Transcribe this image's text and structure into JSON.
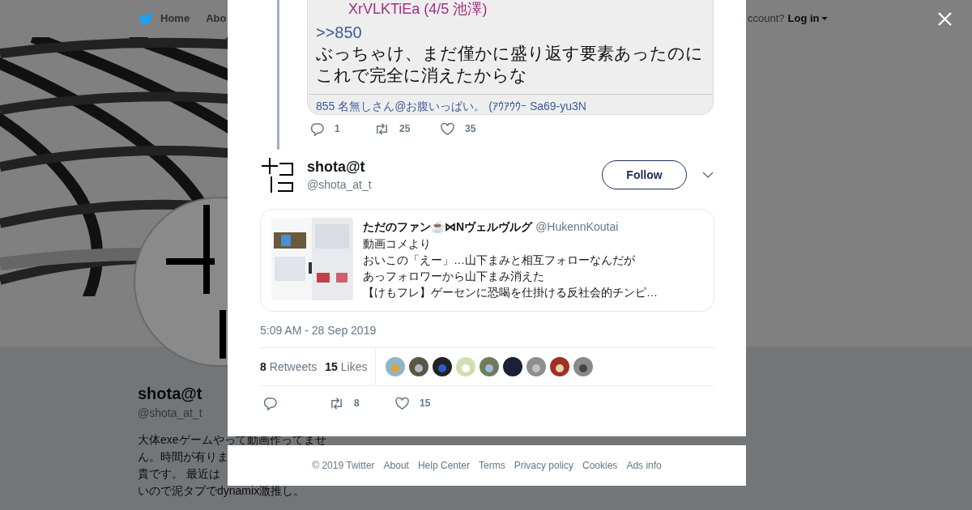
{
  "background_page": {
    "nav": [
      {
        "kind": "home",
        "label": "Home"
      },
      {
        "kind": "plain",
        "label": "Abo"
      }
    ],
    "account_prompt": "ccount?",
    "login": "Log in",
    "profile": {
      "name": "shota@t",
      "handle": "@shota_at_t",
      "bio_lines": [
        "大体exeゲームやって動画作ってませ",
        "ん。時間が有りま",
        "貴です。 最近は",
        "いので泥タブでdynamix激推し。"
      ]
    }
  },
  "thread_reply": {
    "image": {
      "lines": [
        {
          "kind": "id",
          "text": "XrVLKTiEa (4/5 池澤)"
        },
        {
          "kind": "anchor",
          "text": ">>850"
        },
        {
          "kind": "body",
          "text": "ぶっちゃけ、まだ僅かに盛り返す要素あったのに"
        },
        {
          "kind": "body",
          "text": "これで完全に消えたからな"
        },
        {
          "kind": "next",
          "text": "855 名無しさん@お腹いっぱい。 (ｱｳｱｳｳｰ Sa69-yu3N"
        }
      ]
    },
    "actions": [
      {
        "kind": "reply",
        "count": "1"
      },
      {
        "kind": "retweet",
        "count": "25"
      },
      {
        "kind": "like",
        "count": "35"
      }
    ]
  },
  "tweet": {
    "author": {
      "name": "shota@t",
      "handle": "@shota_at_t"
    },
    "follow_button": "Follow",
    "quoted": {
      "name": "ただのファン☕⋈Nヴェルヴルグ",
      "handle": "@HukennKoutai",
      "lines": [
        "動画コメより",
        "おいこの「えー」…山下まみと相互フォローなんだが",
        "あっフォロワーから山下まみ消えた",
        "【けもフレ】ゲーセンに恐喝を仕掛ける反社会的チンピ…"
      ]
    },
    "timestamp": "5:09 AM - 28 Sep 2019",
    "stats": [
      {
        "count": "8",
        "label": "Retweets"
      },
      {
        "count": "15",
        "label": "Likes"
      }
    ],
    "actions": [
      {
        "kind": "reply"
      },
      {
        "kind": "retweet",
        "count": "8"
      },
      {
        "kind": "like",
        "count": "15"
      }
    ]
  },
  "footer": [
    "© 2019 Twitter",
    "About",
    "Help Center",
    "Terms",
    "Privacy policy",
    "Cookies",
    "Ads info"
  ]
}
